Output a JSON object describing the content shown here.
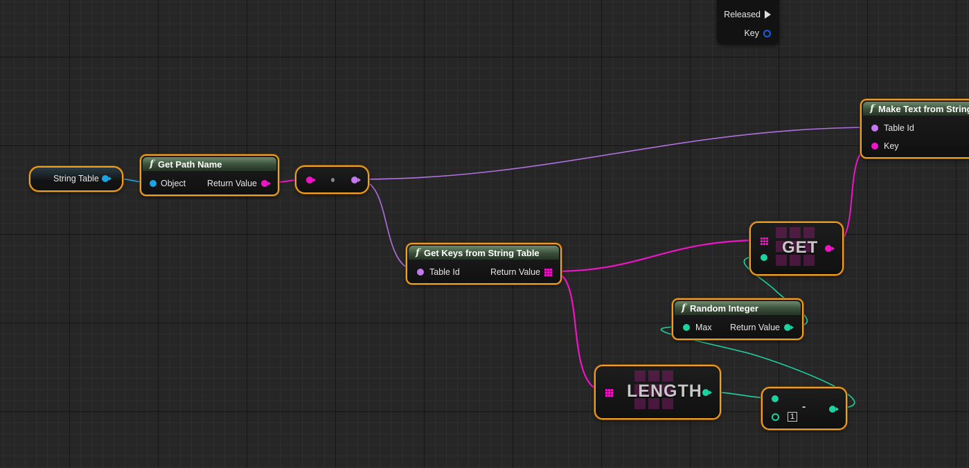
{
  "input_node": {
    "released_label": "Released",
    "key_label": "Key"
  },
  "string_table_node": {
    "label": "String Table"
  },
  "get_path_name_node": {
    "title": "Get Path Name",
    "input_label": "Object",
    "output_label": "Return Value"
  },
  "convert_node": {},
  "get_keys_node": {
    "title": "Get Keys from String Table",
    "input_label": "Table Id",
    "output_label": "Return Value"
  },
  "make_text_node": {
    "title": "Make Text from String Table",
    "input1_label": "Table Id",
    "input2_label": "Key"
  },
  "get_node": {
    "label": "GET"
  },
  "random_integer_node": {
    "title": "Random Integer",
    "input_label": "Max",
    "output_label": "Return Value"
  },
  "length_node": {
    "label": "LENGTH"
  },
  "subtract_node": {
    "operator": "-",
    "literal_value": "1"
  },
  "colors": {
    "object_pin": "#1aa6e6",
    "string_pin": "#f014c8",
    "name_pin": "#c478f0",
    "integer_pin": "#1ed2a0",
    "selection_outline": "#f0a020"
  }
}
